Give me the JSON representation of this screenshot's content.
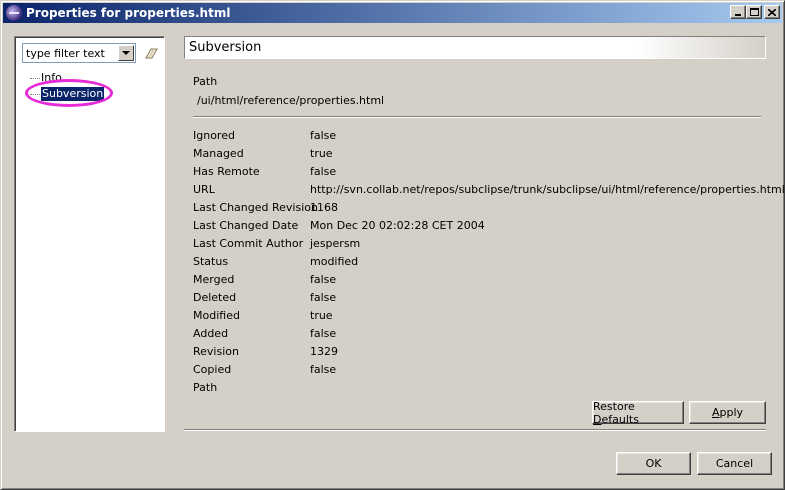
{
  "window": {
    "title": "Properties for properties.html"
  },
  "titlebar_buttons": {
    "minimize": "minimize-icon",
    "maximize": "maximize-icon",
    "close": "close-icon"
  },
  "filter": {
    "text": "type filter text"
  },
  "tree": {
    "items": [
      {
        "label": "Info"
      },
      {
        "label": "Subversion"
      }
    ]
  },
  "page": {
    "title": "Subversion",
    "path_label": "Path",
    "path_value": "/ui/html/reference/properties.html"
  },
  "properties": [
    {
      "key": "Ignored",
      "value": "false"
    },
    {
      "key": "Managed",
      "value": "true"
    },
    {
      "key": "Has Remote",
      "value": "false"
    },
    {
      "key": "URL",
      "value": "http://svn.collab.net/repos/subclipse/trunk/subclipse/ui/html/reference/properties.html"
    },
    {
      "key": "Last Changed Revision",
      "value": "1168"
    },
    {
      "key": "Last Changed Date",
      "value": "Mon Dec 20 02:02:28 CET 2004"
    },
    {
      "key": "Last Commit Author",
      "value": "jespersm"
    },
    {
      "key": "Status",
      "value": "modified"
    },
    {
      "key": "Merged",
      "value": "false"
    },
    {
      "key": "Deleted",
      "value": "false"
    },
    {
      "key": "Modified",
      "value": "true"
    },
    {
      "key": "Added",
      "value": "false"
    },
    {
      "key": "Revision",
      "value": "1329"
    },
    {
      "key": "Copied",
      "value": "false"
    },
    {
      "key": "Path",
      "value": ""
    }
  ],
  "buttons": {
    "restore_defaults_pre": "Restore ",
    "restore_defaults_mnemonic": "D",
    "restore_defaults_post": "efaults",
    "apply_mnemonic": "A",
    "apply_post": "pply",
    "ok": "OK",
    "cancel": "Cancel"
  },
  "colors": {
    "titlebar_start": "#0a246a",
    "titlebar_end": "#a6caf0",
    "selection": "#0a246a",
    "highlight_ring": "#e62ad8",
    "dialog_bg": "#d4d0c8"
  }
}
